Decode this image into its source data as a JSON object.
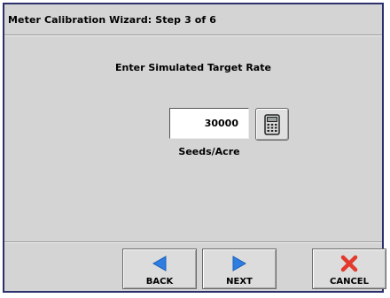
{
  "window": {
    "title": "Meter Calibration Wizard:  Step 3 of 6"
  },
  "main": {
    "prompt": "Enter Simulated Target Rate",
    "rate_value": "30000",
    "unit_label": "Seeds/Acre",
    "calculator_icon": "calculator-icon"
  },
  "buttons": {
    "back": {
      "label": "BACK",
      "icon": "arrow-left-icon"
    },
    "next": {
      "label": "NEXT",
      "icon": "arrow-right-icon"
    },
    "cancel": {
      "label": "CANCEL",
      "icon": "red-x-icon"
    }
  },
  "colors": {
    "frame_border": "#2b2f6b",
    "panel_bg": "#d4d4d4",
    "arrow_blue": "#2f7de1",
    "cancel_red": "#e23b2e"
  }
}
